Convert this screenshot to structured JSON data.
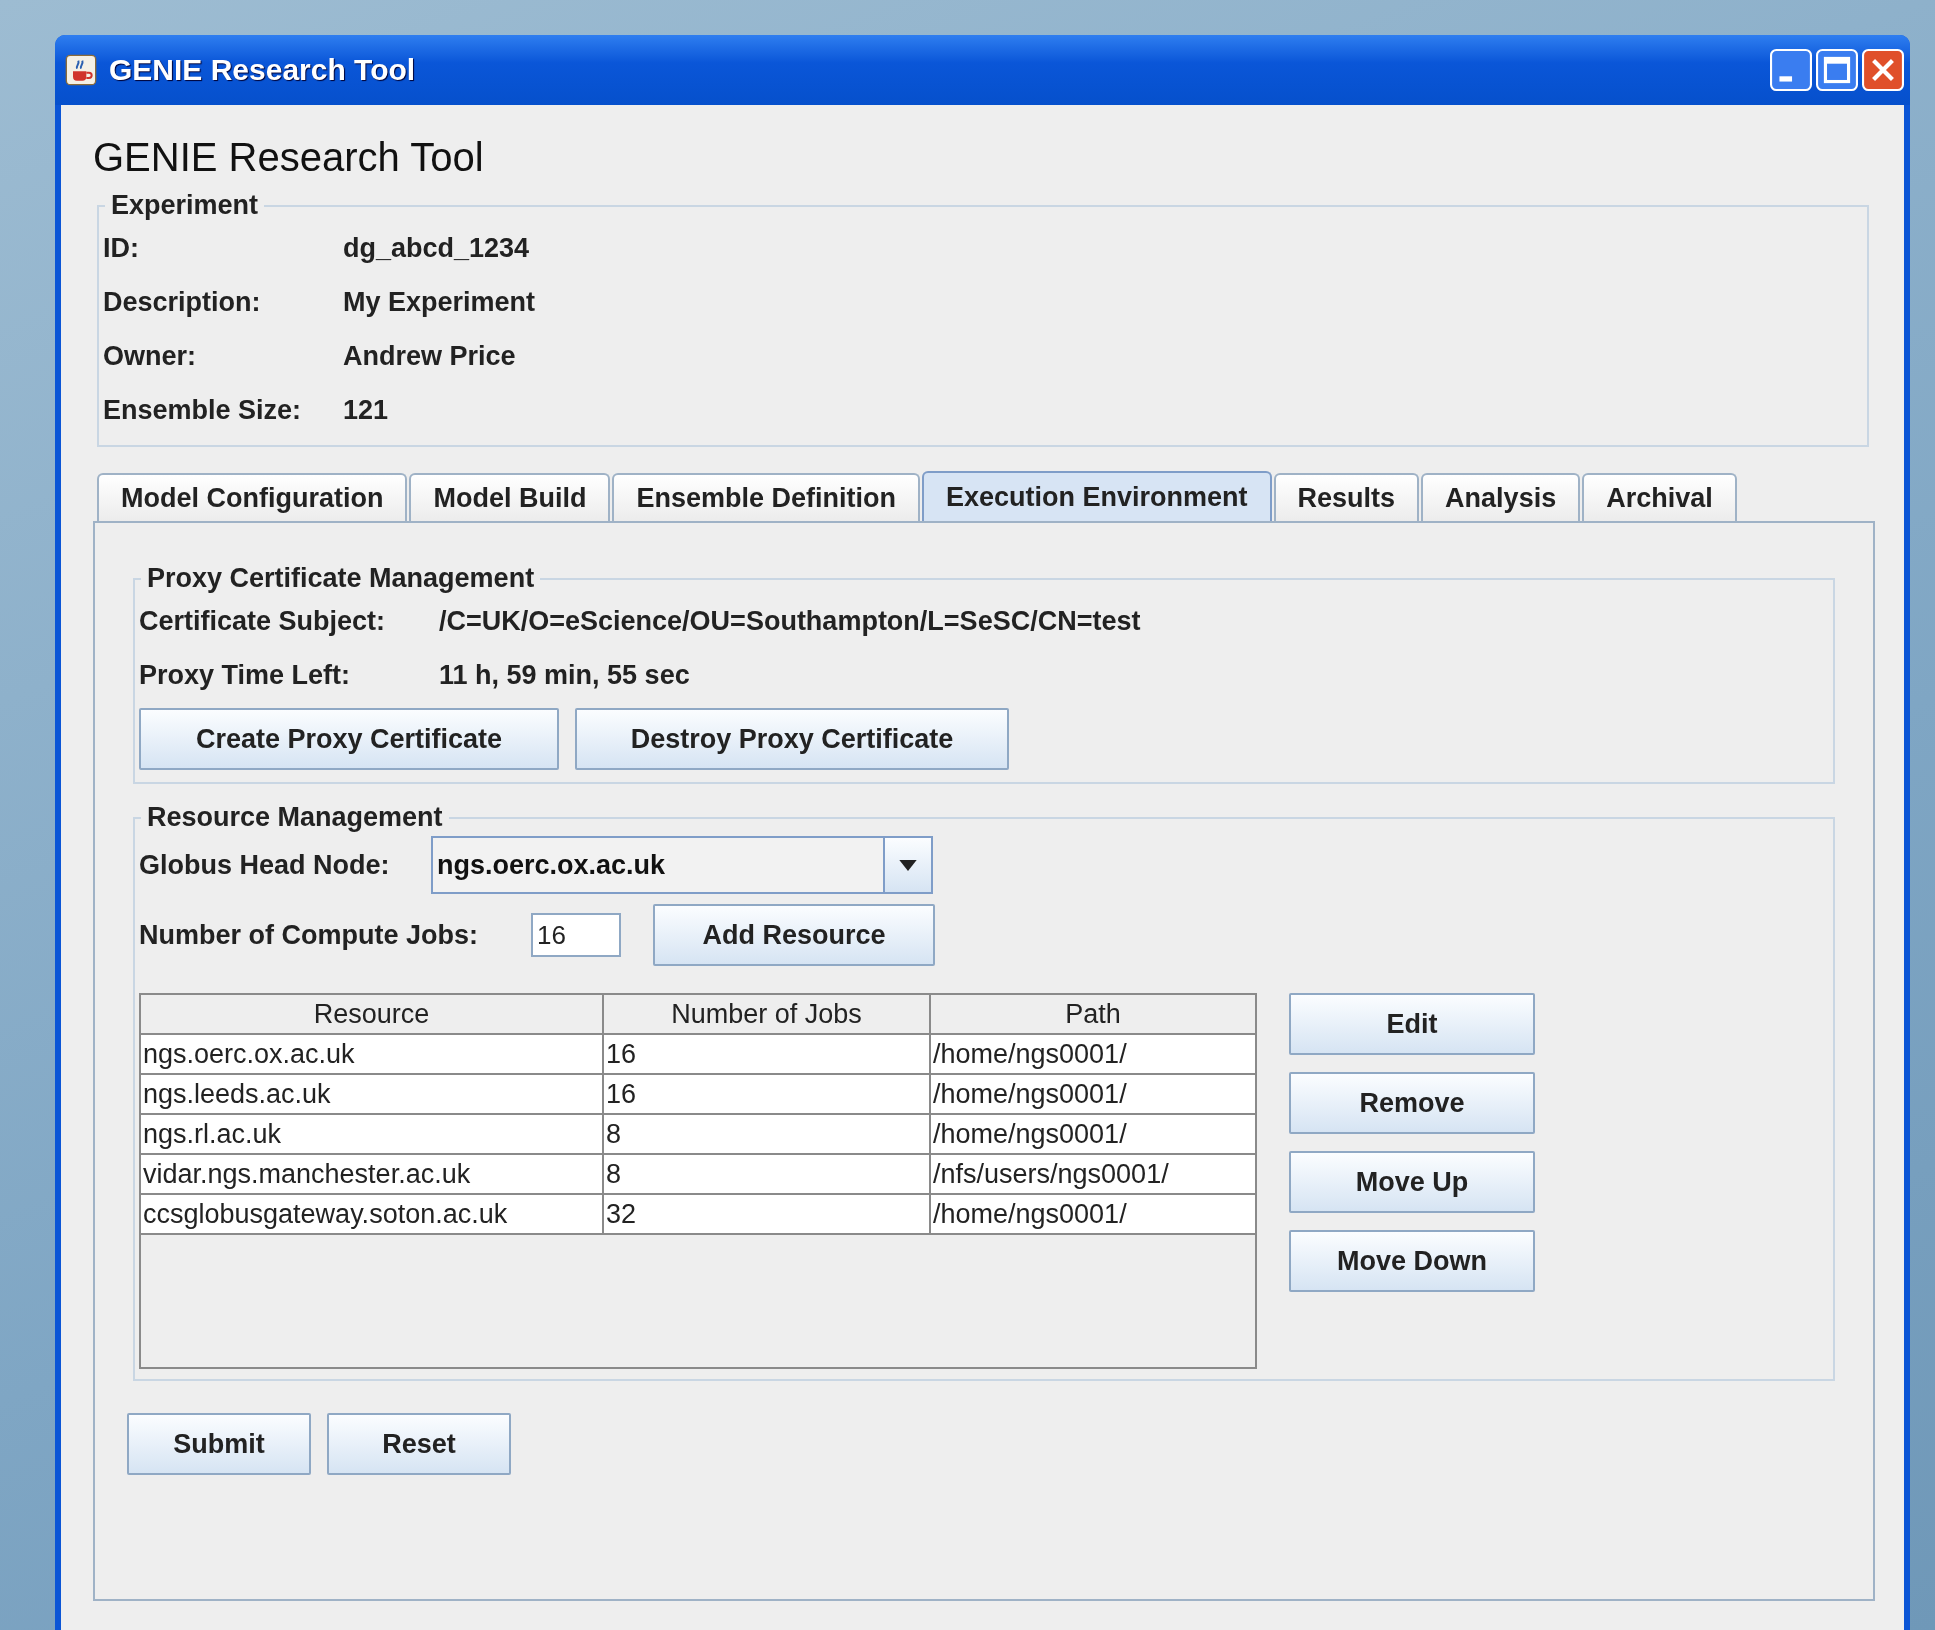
{
  "window": {
    "title": "GENIE Research Tool"
  },
  "heading": "GENIE Research Tool",
  "experiment": {
    "title": "Experiment",
    "fields": [
      {
        "label": "ID:",
        "value": "dg_abcd_1234"
      },
      {
        "label": "Description:",
        "value": "My Experiment"
      },
      {
        "label": "Owner:",
        "value": "Andrew Price"
      },
      {
        "label": "Ensemble Size:",
        "value": "121"
      }
    ]
  },
  "tabs": [
    {
      "label": "Model Configuration",
      "selected": false
    },
    {
      "label": "Model Build",
      "selected": false
    },
    {
      "label": "Ensemble Definition",
      "selected": false
    },
    {
      "label": "Execution Environment",
      "selected": true
    },
    {
      "label": "Results",
      "selected": false
    },
    {
      "label": "Analysis",
      "selected": false
    },
    {
      "label": "Archival",
      "selected": false
    }
  ],
  "proxy": {
    "title": "Proxy Certificate Management",
    "fields": [
      {
        "label": "Certificate Subject:",
        "value": "/C=UK/O=eScience/OU=Southampton/L=SeSC/CN=test"
      },
      {
        "label": "Proxy Time Left:",
        "value": "11 h, 59 min, 55 sec"
      }
    ],
    "buttons": [
      "Create Proxy Certificate",
      "Destroy Proxy Certificate"
    ]
  },
  "resources": {
    "title": "Resource Management",
    "head_node": {
      "label": "Globus Head Node:",
      "value": "ngs.oerc.ox.ac.uk"
    },
    "jobs": {
      "label": "Number of Compute Jobs:",
      "value": "16"
    },
    "add_button": "Add Resource",
    "table": {
      "columns": [
        "Resource",
        "Number of Jobs",
        "Path"
      ],
      "rows": [
        [
          "ngs.oerc.ox.ac.uk",
          "16",
          "/home/ngs0001/"
        ],
        [
          "ngs.leeds.ac.uk",
          "16",
          "/home/ngs0001/"
        ],
        [
          "ngs.rl.ac.uk",
          "8",
          "/home/ngs0001/"
        ],
        [
          "vidar.ngs.manchester.ac.uk",
          "8",
          "/nfs/users/ngs0001/"
        ],
        [
          "ccsglobusgateway.soton.ac.uk",
          "32",
          "/home/ngs0001/"
        ]
      ]
    },
    "side_buttons": [
      "Edit",
      "Remove",
      "Move Up",
      "Move Down"
    ]
  },
  "buttons": [
    "Submit",
    "Reset"
  ]
}
